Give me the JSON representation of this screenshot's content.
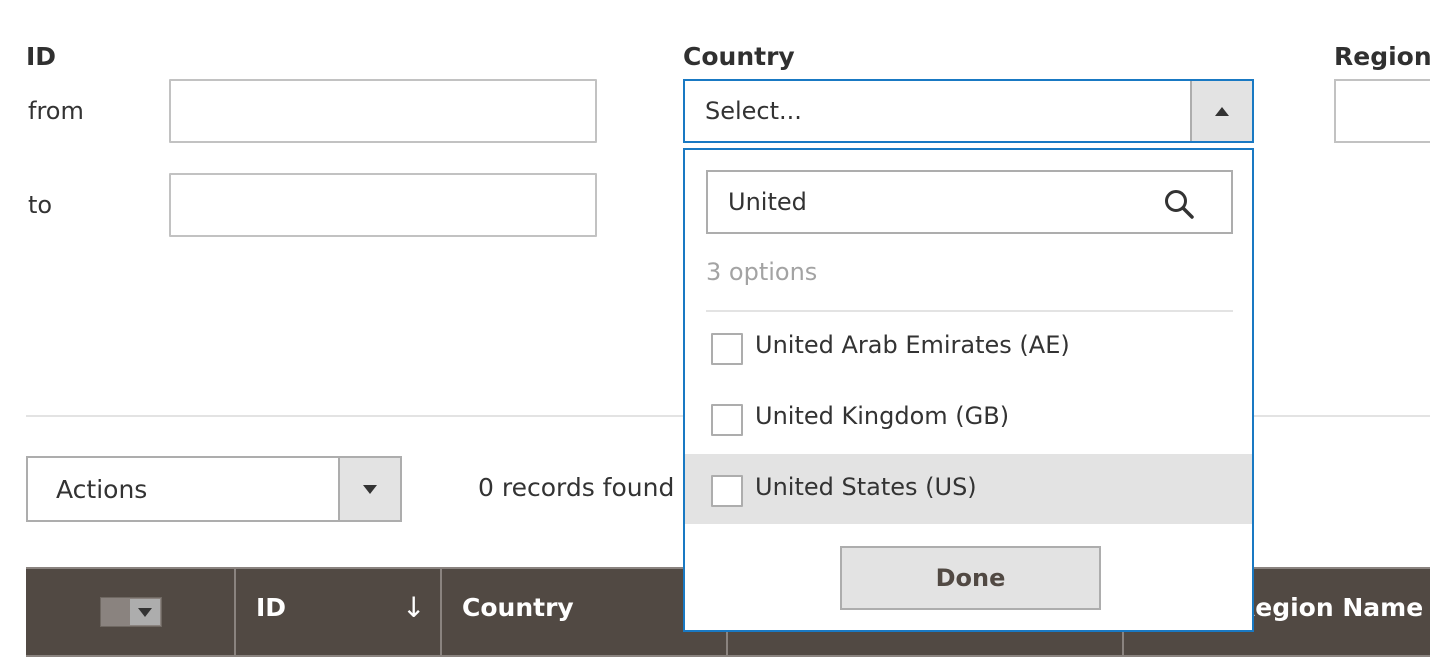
{
  "filters": {
    "id": {
      "label": "ID",
      "from_label": "from",
      "to_label": "to",
      "from_value": "",
      "to_value": ""
    },
    "country": {
      "label": "Country",
      "selected_text": "Select...",
      "search_value": "United",
      "options_count": "3 options",
      "options": [
        {
          "label": "United Arab Emirates (AE)",
          "checked": false
        },
        {
          "label": "United Kingdom (GB)",
          "checked": false
        },
        {
          "label": "United States (US)",
          "checked": false
        }
      ],
      "done_label": "Done"
    },
    "region": {
      "label": "Region",
      "value": ""
    }
  },
  "toolbar": {
    "actions_label": "Actions",
    "records_found": "0 records found"
  },
  "grid": {
    "columns": [
      "ID",
      "Country",
      "Region Name"
    ],
    "sort_indicator": "↓"
  },
  "colors": {
    "accent": "#1979c3",
    "header_bg": "#514943",
    "highlight_bg": "#e3e3e3"
  },
  "icons": [
    "search-icon",
    "caret-up-icon",
    "caret-down-icon",
    "sort-arrow-icon"
  ]
}
